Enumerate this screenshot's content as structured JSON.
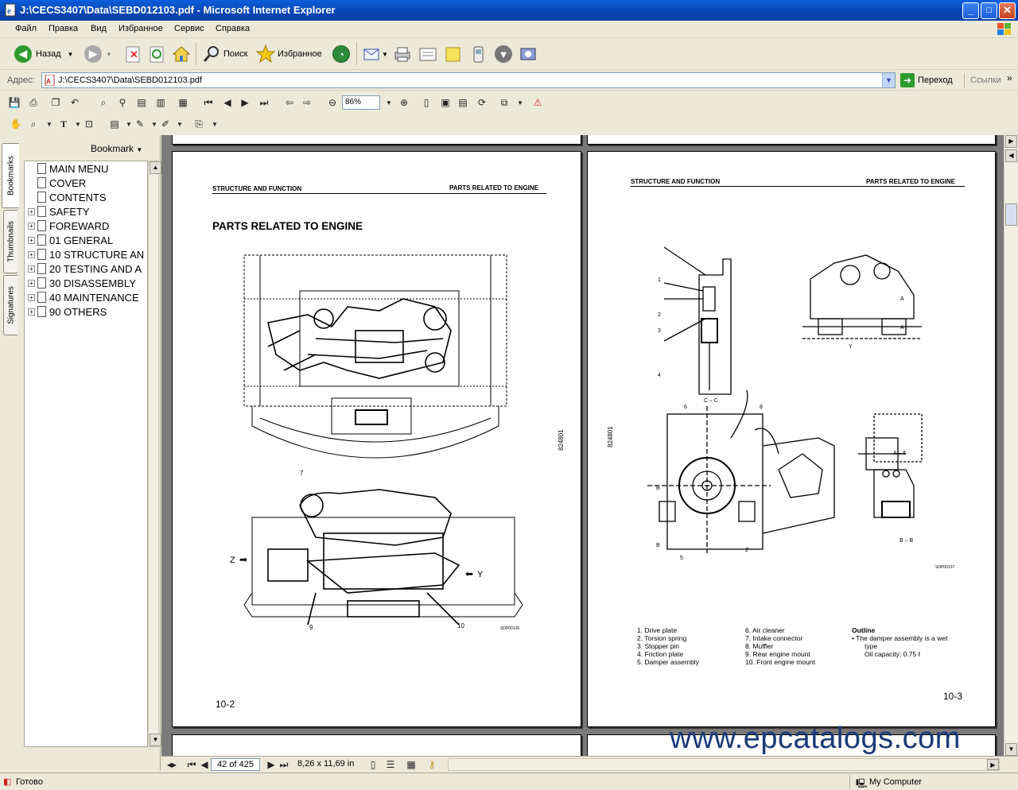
{
  "window": {
    "title": "J:\\CECS3407\\Data\\SEBD012103.pdf - Microsoft Internet Explorer",
    "min": "_",
    "max": "□",
    "close": "✕"
  },
  "menu": [
    "Файл",
    "Правка",
    "Вид",
    "Избранное",
    "Сервис",
    "Справка"
  ],
  "toolbar": {
    "back": "Назад",
    "search": "Поиск",
    "favorites": "Избранное"
  },
  "address": {
    "label": "Адрес:",
    "value": "J:\\CECS3407\\Data\\SEBD012103.pdf",
    "go": "Переход",
    "links": "Ссылки"
  },
  "acrobat": {
    "zoom": "86%"
  },
  "nav_tabs": [
    "Bookmarks",
    "Thumbnails",
    "Signatures"
  ],
  "bookmark_panel": {
    "header": "Bookmark",
    "items": [
      {
        "label": "MAIN MENU",
        "expand": false
      },
      {
        "label": "COVER",
        "expand": false
      },
      {
        "label": "CONTENTS",
        "expand": false
      },
      {
        "label": "SAFETY",
        "expand": true
      },
      {
        "label": "FOREWARD",
        "expand": true
      },
      {
        "label": "01 GENERAL",
        "expand": true
      },
      {
        "label": "10 STRUCTURE AN",
        "expand": true
      },
      {
        "label": "20 TESTING AND A",
        "expand": true
      },
      {
        "label": "30 DISASSEMBLY",
        "expand": true
      },
      {
        "label": "40 MAINTENANCE",
        "expand": true
      },
      {
        "label": "90 OTHERS",
        "expand": true
      }
    ]
  },
  "page_left": {
    "header_left": "STRUCTURE AND FUNCTION",
    "header_right": "PARTS RELATED TO ENGINE",
    "title": "PARTS RELATED TO ENGINE",
    "side_code": "824801",
    "fig_code": "SDP00126",
    "page_number": "10-2",
    "labels": {
      "z": "Z",
      "y": "Y",
      "n7": "7",
      "n9": "9",
      "n10": "10"
    }
  },
  "page_right": {
    "header_left": "STRUCTURE AND FUNCTION",
    "header_right": "PARTS RELATED TO ENGINE",
    "side_code": "824801",
    "fig_code": "SDP00137",
    "page_number": "10-3",
    "view_labels": {
      "cc": "C – C",
      "y": "Y",
      "aa": "A – A",
      "bb": "B – B",
      "z": "Z",
      "a": "A",
      "b": "B"
    },
    "callouts": [
      "1",
      "2",
      "3",
      "4",
      "5",
      "6",
      "8"
    ],
    "parts_col1": [
      "1.   Drive plate",
      "2.   Torsion spring",
      "3.   Stopper pin",
      "4.   Friction plate",
      "5.   Damper assembly"
    ],
    "parts_col2": [
      "6.   Air cleaner",
      "7.   Intake connector",
      "8.   Muffler",
      "9.   Rear engine mount",
      "10.  Front engine mount"
    ],
    "outline_title": "Outline",
    "outline_lines": [
      "•    The damper assembly is a wet",
      "type",
      "Oil capacity: 0.75 ℓ"
    ]
  },
  "nav": {
    "page": "42 of 425",
    "size": "8,26 x 11,69 in"
  },
  "status": {
    "left": "Готово",
    "right": "My Computer"
  },
  "watermark": "www.epcatalogs.com",
  "colors": {
    "title_bar": "#0a5fdc",
    "chrome": "#ece9d8",
    "doc_bg": "#7a7a7a"
  }
}
